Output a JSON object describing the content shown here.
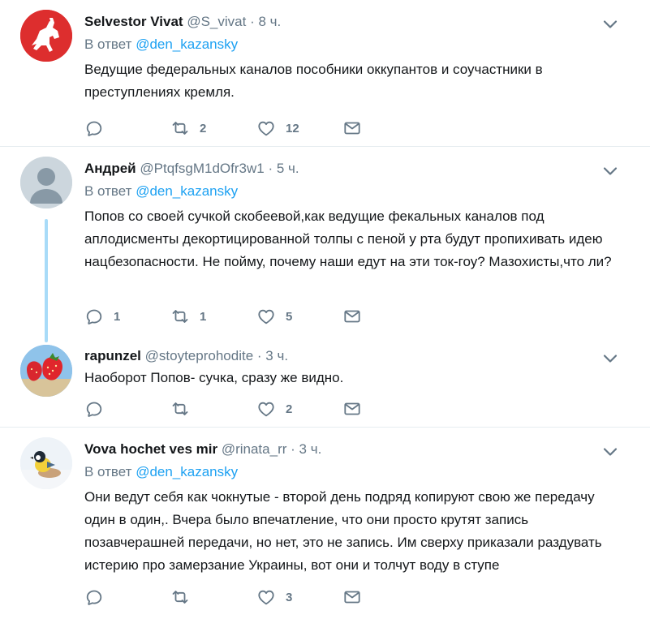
{
  "tweets": [
    {
      "name": "Selvestor Vivat",
      "handle": "@S_vivat",
      "dot": "·",
      "time": "8 ч.",
      "reply_prefix": "В ответ",
      "reply_to": "@den_kazansky",
      "text": "Ведущие федеральных каналов пособники оккупантов и соучастники в преступлениях кремля.",
      "replies": "",
      "retweets": "2",
      "likes": "12"
    },
    {
      "name": "Андрей",
      "handle": "@PtqfsgM1dOfr3w1",
      "dot": "·",
      "time": "5 ч.",
      "reply_prefix": "В ответ",
      "reply_to": "@den_kazansky",
      "text": "Попов со своей сучкой скобеевой,как ведущие фекальных каналов под аплодисменты декортицированной толпы с пеной у рта будут пропихивать идею нацбезопасности. Не пойму, почему наши едут на эти ток-гоу? Мазохисты,что ли?",
      "replies": "1",
      "retweets": "1",
      "likes": "5"
    },
    {
      "name": "rapunzel",
      "handle": "@stoyteprohodite",
      "dot": "·",
      "time": "3 ч.",
      "text": "Наоборот Попов- сучка, сразу же видно.",
      "replies": "",
      "retweets": "",
      "likes": "2"
    },
    {
      "name": "Vova hochet ves mir",
      "handle": "@rinata_rr",
      "dot": "·",
      "time": "3 ч.",
      "reply_prefix": "В ответ",
      "reply_to": "@den_kazansky",
      "text": "Они ведут себя как чокнутые - второй день подряд копируют свою же передачу один в один,. Вчера было впечатление, что они просто крутят запись позавчерашней передачи, но нет, это не запись. Им сверху приказали раздувать истерию про замерзание Украины, вот они и толчут воду в ступе",
      "replies": "",
      "retweets": "",
      "likes": "3"
    }
  ],
  "colors": {
    "accent": "#1da1f2",
    "muted": "#657786",
    "text": "#14171a",
    "separator": "#e6ecf0",
    "thread_line": "#a8dbf8"
  }
}
